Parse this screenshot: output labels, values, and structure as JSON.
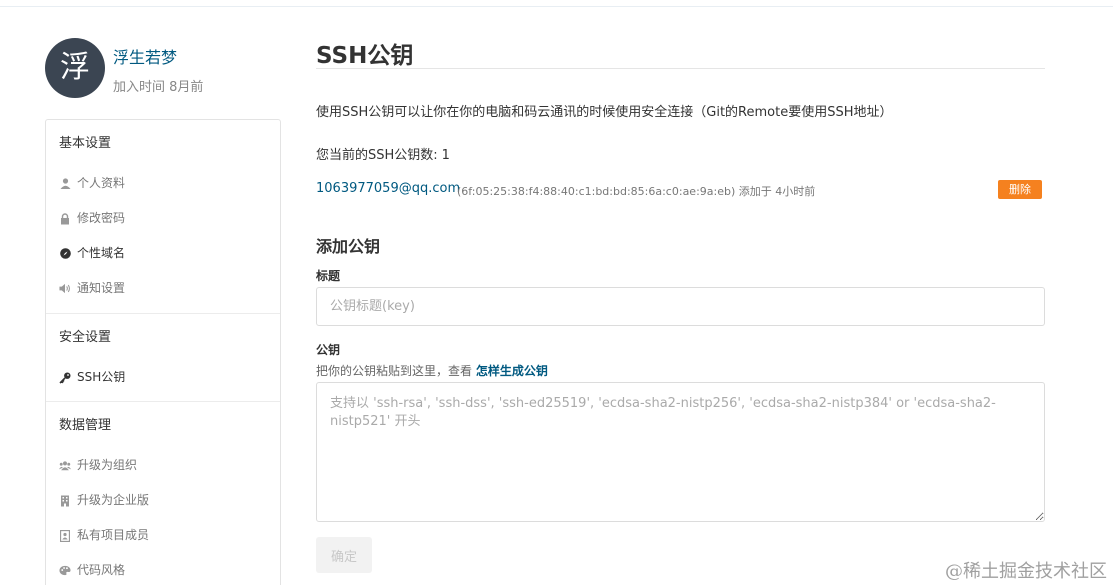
{
  "profile": {
    "avatar_char": "浮",
    "name": "浮生若梦",
    "joined": "加入时间 8月前"
  },
  "menu": {
    "groups": [
      {
        "title": "基本设置",
        "items": [
          {
            "label": "个人资料",
            "icon": "user-icon"
          },
          {
            "label": "修改密码",
            "icon": "lock-icon"
          },
          {
            "label": "个性域名",
            "icon": "compass-icon",
            "active": true
          },
          {
            "label": "通知设置",
            "icon": "volume-icon"
          }
        ]
      },
      {
        "title": "安全设置",
        "items": [
          {
            "label": "SSH公钥",
            "icon": "key-icon",
            "active": true
          }
        ]
      },
      {
        "title": "数据管理",
        "items": [
          {
            "label": "升级为组织",
            "icon": "group-icon"
          },
          {
            "label": "升级为企业版",
            "icon": "building-icon"
          },
          {
            "label": "私有项目成员",
            "icon": "id-card-icon"
          },
          {
            "label": "代码风格",
            "icon": "palette-icon"
          }
        ]
      }
    ]
  },
  "main": {
    "title": "SSH公钥",
    "description": "使用SSH公钥可以让你在你的电脑和码云通讯的时候使用安全连接（Git的Remote要使用SSH地址）",
    "count_label": "您当前的SSH公钥数:",
    "count_value": "1",
    "key": {
      "email": "1063977059@qq.com",
      "fingerprint": "(6f:05:25:38:f4:88:40:c1:bd:bd:85:6a:c0:ae:9a:eb) 添加于 4小时前",
      "delete_label": "删除"
    },
    "add_title": "添加公钥",
    "title_label": "标题",
    "title_placeholder": "公钥标题(key)",
    "key_label": "公钥",
    "hint_text": "把你的公钥粘贴到这里，查看 ",
    "hint_link": "怎样生成公钥",
    "key_placeholder": "支持以 'ssh-rsa', 'ssh-dss', 'ssh-ed25519', 'ecdsa-sha2-nistp256', 'ecdsa-sha2-nistp384' or 'ecdsa-sha2-nistp521' 开头",
    "confirm_label": "确定"
  },
  "watermark": "@稀土掘金技术社区",
  "colors": {
    "link": "#005980",
    "delete": "#f5811f",
    "avatar_bg": "#3b4552"
  }
}
